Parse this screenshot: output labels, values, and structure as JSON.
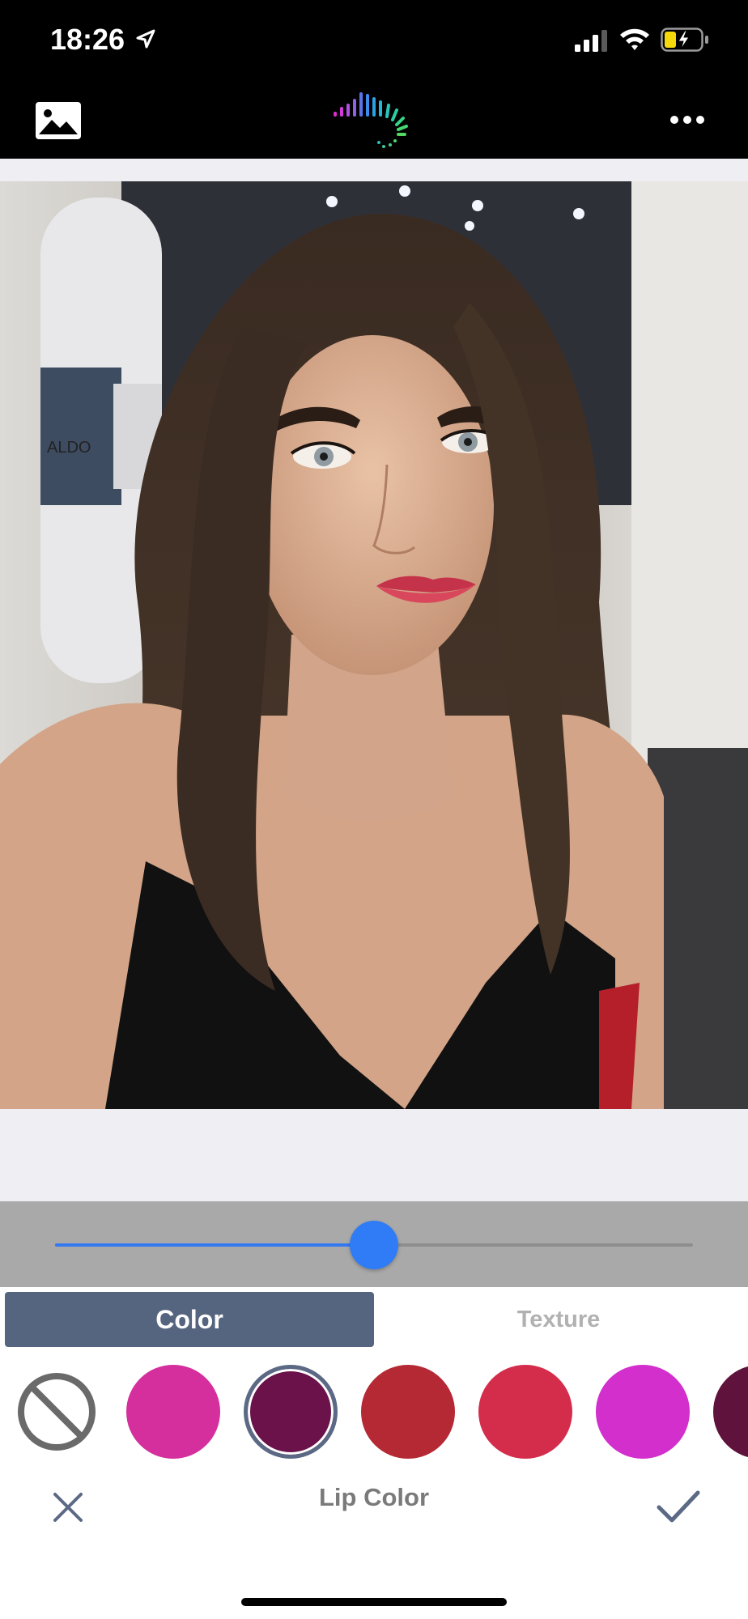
{
  "status_bar": {
    "time": "18:26",
    "icons": [
      "location-arrow-icon",
      "cellular-signal-icon",
      "wifi-icon",
      "battery-charging-icon"
    ],
    "battery_level": 0.3
  },
  "toolbar": {
    "left_icon": "gallery-icon",
    "center_icon": "app-logo-icon",
    "right_icon": "more-icon"
  },
  "photo": {
    "background_sign": "ALDO"
  },
  "intensity_slider": {
    "value": 0.5
  },
  "tabs": [
    {
      "label": "Color",
      "selected": true
    },
    {
      "label": "Texture",
      "selected": false
    }
  ],
  "swatches": [
    {
      "type": "none",
      "icon": "no-color-icon"
    },
    {
      "color": "#d42f9d"
    },
    {
      "color": "#6a1249",
      "selected": true
    },
    {
      "color": "#b52935"
    },
    {
      "color": "#d42d4c"
    },
    {
      "color": "#d22fcc"
    },
    {
      "color": "#5e123c"
    }
  ],
  "footer": {
    "title": "Lip Color",
    "cancel_icon": "close-icon",
    "confirm_icon": "checkmark-icon"
  },
  "colors": {
    "accent": "#2f7cf6",
    "tab_selected": "#56657f"
  }
}
